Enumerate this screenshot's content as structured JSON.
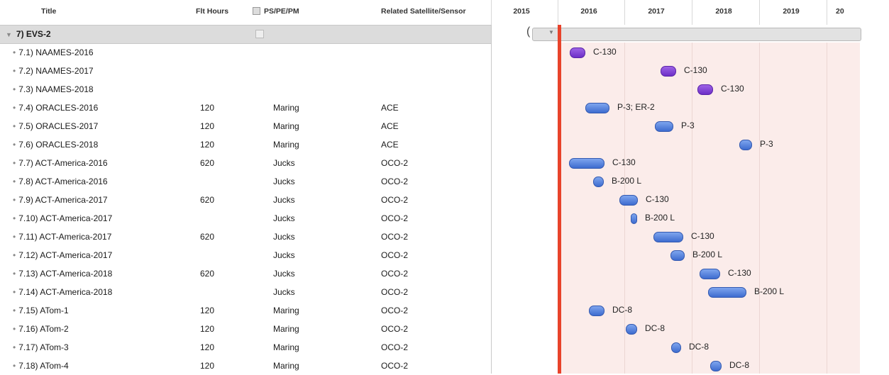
{
  "columns": {
    "title": "Title",
    "flt_hours": "Flt Hours",
    "ps": "PS/PE/PM",
    "related": "Related Satellite/Sensor"
  },
  "years": [
    "2015",
    "2016",
    "2017",
    "2018",
    "2019",
    "20"
  ],
  "group": {
    "label": "7) EVS-2"
  },
  "rows": [
    {
      "title": "7.1) NAAMES-2016",
      "hours": "",
      "ps": "",
      "sensor": "",
      "aircraft": "C-130",
      "color": "purple"
    },
    {
      "title": "7.2) NAAMES-2017",
      "hours": "",
      "ps": "",
      "sensor": "",
      "aircraft": "C-130",
      "color": "purple"
    },
    {
      "title": "7.3) NAAMES-2018",
      "hours": "",
      "ps": "",
      "sensor": "",
      "aircraft": "C-130",
      "color": "purple"
    },
    {
      "title": "7.4) ORACLES-2016",
      "hours": "120",
      "ps": "Maring",
      "sensor": "ACE",
      "aircraft": "P-3; ER-2",
      "color": "blue"
    },
    {
      "title": "7.5) ORACLES-2017",
      "hours": "120",
      "ps": "Maring",
      "sensor": "ACE",
      "aircraft": "P-3",
      "color": "blue"
    },
    {
      "title": "7.6) ORACLES-2018",
      "hours": "120",
      "ps": "Maring",
      "sensor": "ACE",
      "aircraft": "P-3",
      "color": "blue"
    },
    {
      "title": "7.7) ACT-America-2016",
      "hours": "620",
      "ps": "Jucks",
      "sensor": "OCO-2",
      "aircraft": "C-130",
      "color": "blue"
    },
    {
      "title": "7.8) ACT-America-2016",
      "hours": "",
      "ps": "Jucks",
      "sensor": "OCO-2",
      "aircraft": "B-200 L",
      "color": "blue"
    },
    {
      "title": "7.9) ACT-America-2017",
      "hours": "620",
      "ps": "Jucks",
      "sensor": "OCO-2",
      "aircraft": "C-130",
      "color": "blue"
    },
    {
      "title": "7.10) ACT-America-2017",
      "hours": "",
      "ps": "Jucks",
      "sensor": "OCO-2",
      "aircraft": "B-200 L",
      "color": "blue"
    },
    {
      "title": "7.11) ACT-America-2017",
      "hours": "620",
      "ps": "Jucks",
      "sensor": "OCO-2",
      "aircraft": "C-130",
      "color": "blue"
    },
    {
      "title": "7.12) ACT-America-2017",
      "hours": "",
      "ps": "Jucks",
      "sensor": "OCO-2",
      "aircraft": "B-200 L",
      "color": "blue"
    },
    {
      "title": "7.13) ACT-America-2018",
      "hours": "620",
      "ps": "Jucks",
      "sensor": "OCO-2",
      "aircraft": "C-130",
      "color": "blue"
    },
    {
      "title": "7.14) ACT-America-2018",
      "hours": "",
      "ps": "Jucks",
      "sensor": "OCO-2",
      "aircraft": "B-200 L",
      "color": "blue"
    },
    {
      "title": "7.15) ATom-1",
      "hours": "120",
      "ps": "Maring",
      "sensor": "OCO-2",
      "aircraft": "DC-8",
      "color": "blue"
    },
    {
      "title": "7.16) ATom-2",
      "hours": "120",
      "ps": "Maring",
      "sensor": "OCO-2",
      "aircraft": "DC-8",
      "color": "blue"
    },
    {
      "title": "7.17) ATom-3",
      "hours": "120",
      "ps": "Maring",
      "sensor": "OCO-2",
      "aircraft": "DC-8",
      "color": "blue"
    },
    {
      "title": "7.18) ATom-4",
      "hours": "120",
      "ps": "Maring",
      "sensor": "OCO-2",
      "aircraft": "DC-8",
      "color": "blue"
    }
  ]
}
